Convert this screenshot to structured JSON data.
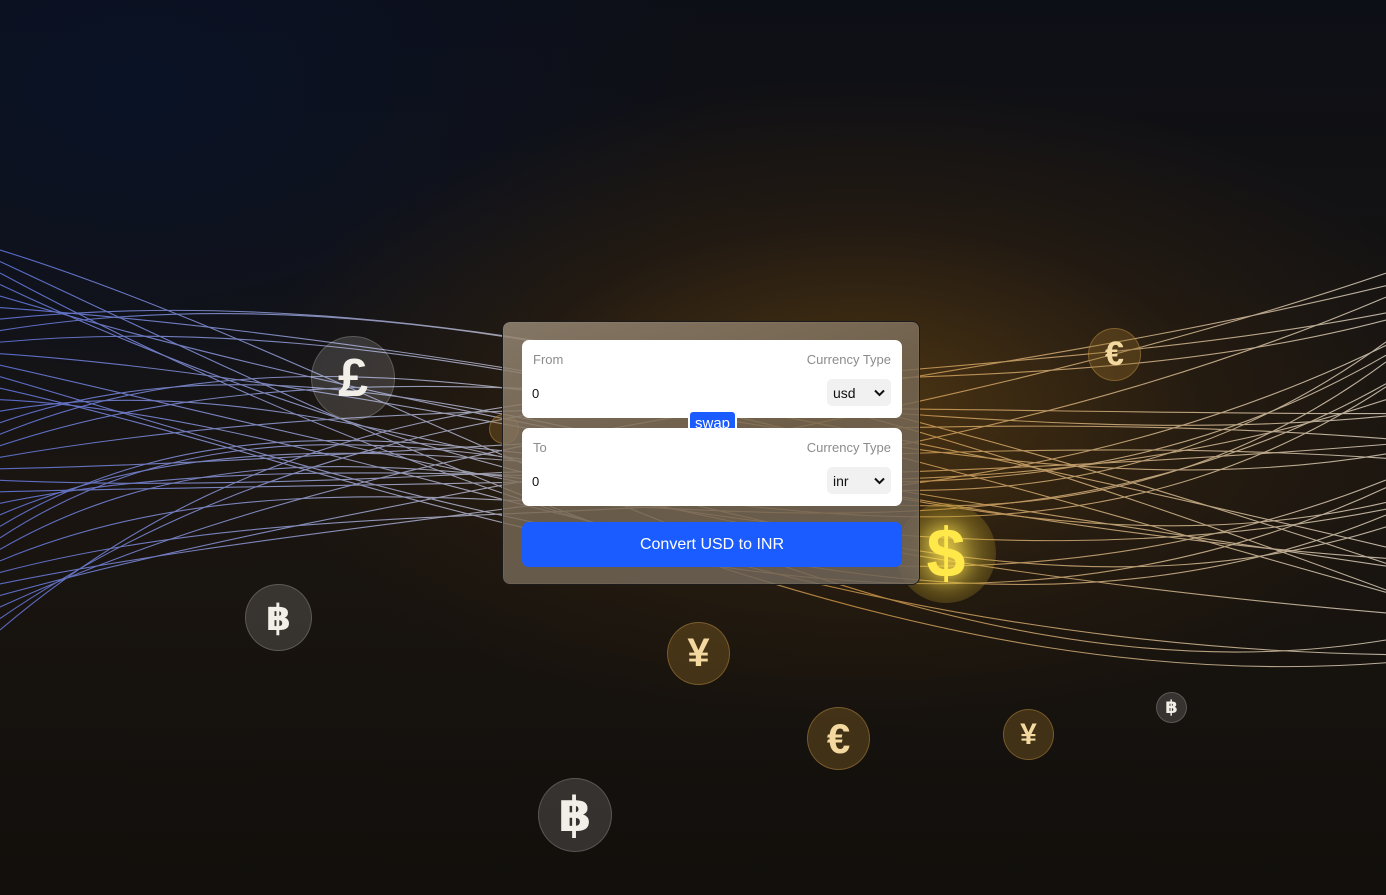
{
  "converter": {
    "from": {
      "label": "From",
      "type_label": "Currency Type",
      "amount": "0",
      "currency": "usd"
    },
    "to": {
      "label": "To",
      "type_label": "Currency Type",
      "amount": "0",
      "currency": "inr"
    },
    "swap_label": "swap",
    "convert_label": "Convert USD to INR"
  },
  "background_coins": {
    "pound": "£",
    "euro": "€",
    "bitcoin": "฿",
    "yen": "¥",
    "dollar": "$"
  },
  "colors": {
    "accent": "#1a5cff",
    "card": "#8a7a66",
    "wave_blue": "#6f86ff",
    "wave_gold": "#e0a24a"
  }
}
